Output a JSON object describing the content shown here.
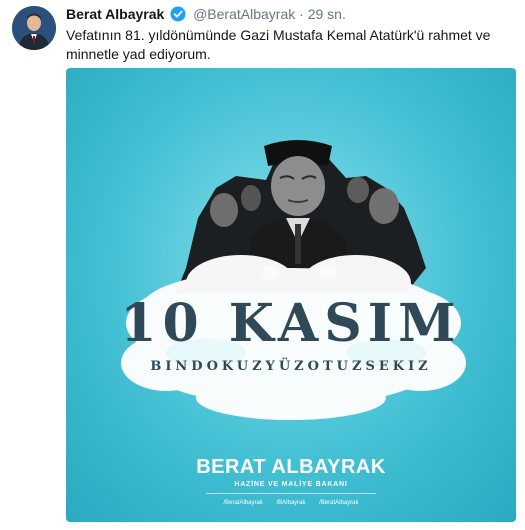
{
  "tweet": {
    "author_name": "Berat Albayrak",
    "handle": "@BeratAlbayrak",
    "separator": "·",
    "time": "29 sn.",
    "text": "Vefatının 81. yıldönümünde Gazi Mustafa Kemal Atatürk'ü rahmet ve minnetle yad ediyorum.",
    "verified_color": "#1da1f2"
  },
  "poster": {
    "title": "10 KASIM",
    "year_words": "BINDOKUZYÜZOTUZSEKIZ",
    "brand_name": "BERAT ALBAYRAK",
    "brand_subtitle": "HAZİNE VE MALİYE BAKANI",
    "socials": [
      "/BeratAlbayrak",
      "/BAlbayrak",
      "/BeratAlbayrak"
    ],
    "background_color": "#41bfd3",
    "text_color": "#2f4958"
  }
}
